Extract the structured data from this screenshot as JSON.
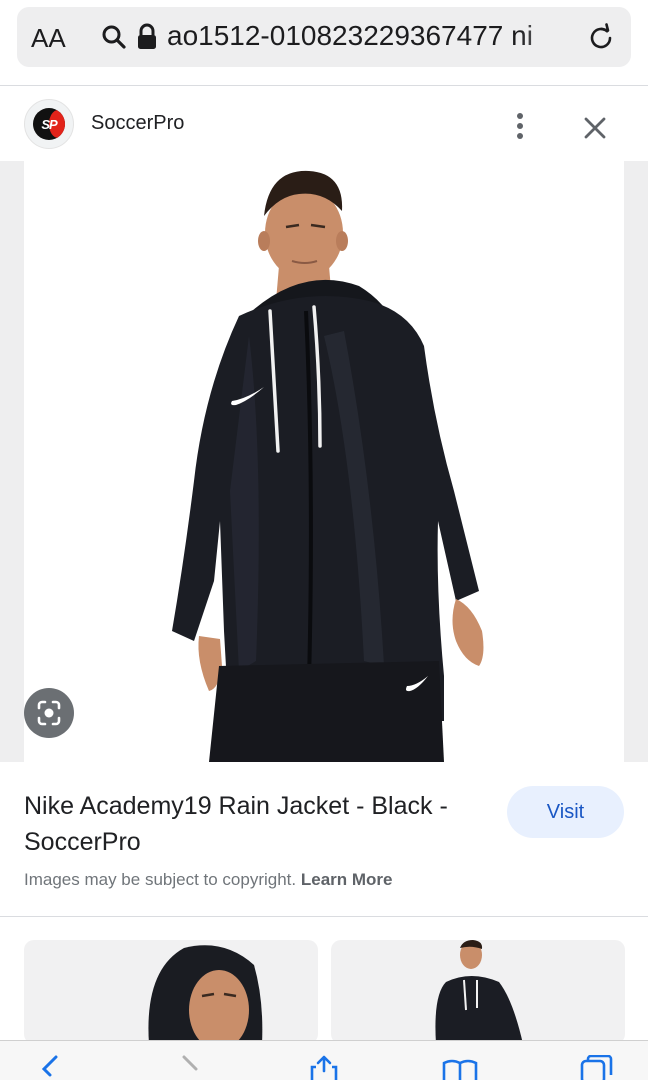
{
  "browser": {
    "text_size_label": "AA",
    "url": "ao1512-010823229367477 ni"
  },
  "source": {
    "name": "SoccerPro",
    "logo_text": "SP"
  },
  "result": {
    "title": "Nike Academy19 Rain Jacket - Black - SoccerPro",
    "visit_label": "Visit",
    "copyright_text": "Images may be subject to copyright.",
    "learn_more_label": "Learn More"
  },
  "icons": {
    "search": "search-icon",
    "lock": "lock-icon",
    "reload": "reload-icon",
    "more": "more-vert-icon",
    "close": "close-icon",
    "lens": "lens-icon",
    "back": "back-icon",
    "forward": "forward-icon",
    "share": "share-icon",
    "bookmarks": "bookmarks-icon",
    "tabs": "tabs-icon"
  },
  "colors": {
    "accent": "#1a57c4",
    "visit_bg": "#e8f0fe",
    "address_bar_bg": "#eeeeef"
  }
}
